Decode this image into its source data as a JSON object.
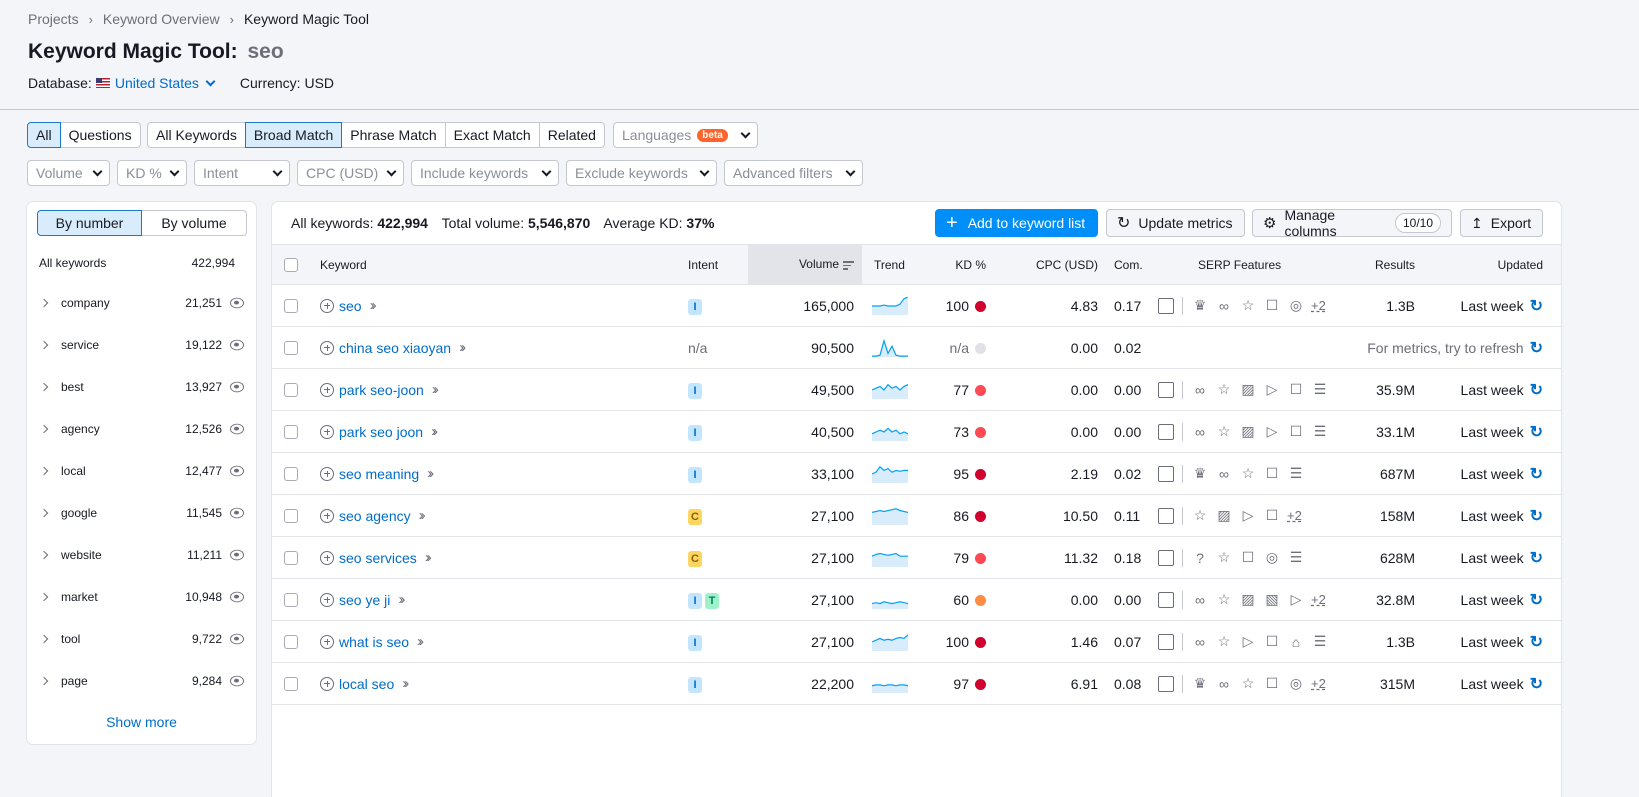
{
  "breadcrumb": [
    "Projects",
    "Keyword Overview",
    "Keyword Magic Tool"
  ],
  "title": "Keyword Magic Tool:",
  "query": "seo",
  "database_label": "Database:",
  "database_value": "United States",
  "currency": "Currency: USD",
  "match_tabs_a": [
    "All",
    "Questions"
  ],
  "match_tabs_b": [
    "All Keywords",
    "Broad Match",
    "Phrase Match",
    "Exact Match",
    "Related"
  ],
  "languages": "Languages",
  "beta": "beta",
  "filters": [
    "Volume",
    "KD %",
    "Intent",
    "CPC (USD)",
    "Include keywords",
    "Exclude keywords",
    "Advanced filters"
  ],
  "sidebar": {
    "toggle": [
      "By number",
      "By volume"
    ],
    "all_label": "All keywords",
    "all_count": "422,994",
    "items": [
      {
        "name": "company",
        "count": "21,251"
      },
      {
        "name": "service",
        "count": "19,122"
      },
      {
        "name": "best",
        "count": "13,927"
      },
      {
        "name": "agency",
        "count": "12,526"
      },
      {
        "name": "local",
        "count": "12,477"
      },
      {
        "name": "google",
        "count": "11,545"
      },
      {
        "name": "website",
        "count": "11,211"
      },
      {
        "name": "market",
        "count": "10,948"
      },
      {
        "name": "tool",
        "count": "9,722"
      },
      {
        "name": "page",
        "count": "9,284"
      }
    ],
    "show_more": "Show more"
  },
  "summary": {
    "all_label": "All keywords:",
    "all_value": "422,994",
    "vol_label": "Total volume:",
    "vol_value": "5,546,870",
    "kd_label": "Average KD:",
    "kd_value": "37%"
  },
  "buttons": {
    "add": "Add to keyword list",
    "update": "Update metrics",
    "manage": "Manage columns",
    "manage_count": "10/10",
    "export": "Export"
  },
  "columns": [
    "Keyword",
    "Intent",
    "Volume",
    "Trend",
    "KD %",
    "CPC (USD)",
    "Com.",
    "SERP Features",
    "Results",
    "Updated"
  ],
  "colors": {
    "kd_hard": "#d1002f",
    "kd_mid": "#ff4953",
    "kd_med": "#ff8c43",
    "kd_na": "#e0e1e9"
  },
  "rows": [
    {
      "keyword": "seo",
      "intent": [
        "I"
      ],
      "volume": "165,000",
      "trend": [
        0.5,
        0.5,
        0.5,
        0.55,
        0.5,
        0.5,
        0.5,
        0.6,
        0.9,
        1
      ],
      "kd": "100",
      "kdc": "#d1002f",
      "cpc": "4.83",
      "com": "0.17",
      "serp": [
        "crown",
        "link",
        "star",
        "chat",
        "pin"
      ],
      "more": "+2",
      "results": "1.3B",
      "updated": "Last week"
    },
    {
      "keyword": "china seo xiaoyan",
      "intent": [],
      "intent_text": "n/a",
      "volume": "90,500",
      "trend": [
        0.05,
        0.05,
        0.1,
        0.9,
        0.2,
        0.6,
        0.1,
        0.05,
        0.05,
        0.05
      ],
      "kd": "n/a",
      "kdc": "#e0e1e9",
      "cpc": "0.00",
      "com": "0.02",
      "serp": null,
      "note": "For metrics, try to refresh"
    },
    {
      "keyword": "park seo-joon",
      "intent": [
        "I"
      ],
      "volume": "49,500",
      "trend": [
        0.5,
        0.6,
        0.7,
        0.5,
        0.8,
        0.6,
        0.7,
        0.5,
        0.7,
        0.8
      ],
      "kd": "77",
      "kdc": "#ff4953",
      "cpc": "0.00",
      "com": "0.00",
      "serp": [
        "link",
        "star",
        "image",
        "video",
        "chat",
        "list"
      ],
      "more": "",
      "results": "35.9M",
      "updated": "Last week"
    },
    {
      "keyword": "park seo joon",
      "intent": [
        "I"
      ],
      "volume": "40,500",
      "trend": [
        0.4,
        0.5,
        0.6,
        0.5,
        0.7,
        0.5,
        0.6,
        0.4,
        0.5,
        0.4
      ],
      "kd": "73",
      "kdc": "#ff4953",
      "cpc": "0.00",
      "com": "0.00",
      "serp": [
        "link",
        "star",
        "image",
        "video",
        "chat",
        "list"
      ],
      "more": "",
      "results": "33.1M",
      "updated": "Last week"
    },
    {
      "keyword": "seo meaning",
      "intent": [
        "I"
      ],
      "volume": "33,100",
      "trend": [
        0.5,
        0.6,
        0.9,
        0.7,
        0.8,
        0.6,
        0.7,
        0.65,
        0.7,
        0.7
      ],
      "kd": "95",
      "kdc": "#d1002f",
      "cpc": "2.19",
      "com": "0.02",
      "serp": [
        "crown",
        "link",
        "star",
        "chat",
        "list"
      ],
      "more": "",
      "results": "687M",
      "updated": "Last week"
    },
    {
      "keyword": "seo agency",
      "intent": [
        "C"
      ],
      "volume": "27,100",
      "trend": [
        0.7,
        0.75,
        0.8,
        0.75,
        0.8,
        0.85,
        0.9,
        0.8,
        0.75,
        0.7
      ],
      "kd": "86",
      "kdc": "#d1002f",
      "cpc": "10.50",
      "com": "0.11",
      "serp": [
        "star",
        "image",
        "video",
        "chat"
      ],
      "more": "+2",
      "results": "158M",
      "updated": "Last week"
    },
    {
      "keyword": "seo services",
      "intent": [
        "C"
      ],
      "volume": "27,100",
      "trend": [
        0.6,
        0.7,
        0.75,
        0.7,
        0.65,
        0.7,
        0.75,
        0.6,
        0.6,
        0.6
      ],
      "kd": "79",
      "kdc": "#ff4953",
      "cpc": "11.32",
      "com": "0.18",
      "serp": [
        "faq",
        "star",
        "chat",
        "pin",
        "list"
      ],
      "more": "",
      "results": "628M",
      "updated": "Last week"
    },
    {
      "keyword": "seo ye ji",
      "intent": [
        "I",
        "T"
      ],
      "volume": "27,100",
      "trend": [
        0.3,
        0.35,
        0.3,
        0.4,
        0.35,
        0.3,
        0.35,
        0.4,
        0.35,
        0.3
      ],
      "kd": "60",
      "kdc": "#ff8c43",
      "cpc": "0.00",
      "com": "0.00",
      "serp": [
        "link",
        "star",
        "image",
        "image2",
        "video"
      ],
      "more": "+2",
      "results": "32.8M",
      "updated": "Last week"
    },
    {
      "keyword": "what is seo",
      "intent": [
        "I"
      ],
      "volume": "27,100",
      "trend": [
        0.5,
        0.6,
        0.7,
        0.6,
        0.65,
        0.6,
        0.7,
        0.75,
        0.7,
        0.9
      ],
      "kd": "100",
      "kdc": "#d1002f",
      "cpc": "1.46",
      "com": "0.07",
      "serp": [
        "link",
        "star",
        "video",
        "chat",
        "cap",
        "list"
      ],
      "more": "",
      "results": "1.3B",
      "updated": "Last week"
    },
    {
      "keyword": "local seo",
      "intent": [
        "I"
      ],
      "volume": "22,200",
      "trend": [
        0.4,
        0.45,
        0.45,
        0.4,
        0.45,
        0.45,
        0.4,
        0.45,
        0.45,
        0.4
      ],
      "kd": "97",
      "kdc": "#d1002f",
      "cpc": "6.91",
      "com": "0.08",
      "serp": [
        "crown",
        "link",
        "star",
        "chat",
        "pin"
      ],
      "more": "+2",
      "results": "315M",
      "updated": "Last week"
    }
  ]
}
